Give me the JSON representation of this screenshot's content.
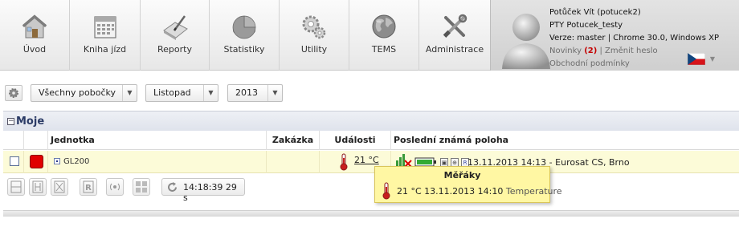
{
  "nav": {
    "items": [
      {
        "label": "Úvod",
        "icon": "home-icon"
      },
      {
        "label": "Kniha jízd",
        "icon": "calendar-icon"
      },
      {
        "label": "Reporty",
        "icon": "report-icon"
      },
      {
        "label": "Statistiky",
        "icon": "pie-chart-icon"
      },
      {
        "label": "Utility",
        "icon": "gears-icon"
      },
      {
        "label": "TEMS",
        "icon": "globe-icon"
      },
      {
        "label": "Administrace",
        "icon": "tools-icon"
      }
    ]
  },
  "user": {
    "name": "Potůček Vít (potucek2)",
    "company": "PTY Potucek_testy",
    "version_line": "Verze: master  |  Chrome 30.0, Windows XP",
    "news_label": "Novinky",
    "news_count": "(2)",
    "separator": "|",
    "change_password": "Změnit heslo",
    "terms": "Obchodní podmínky",
    "language_flag": "czech-flag"
  },
  "filters": {
    "branch": "Všechny pobočky",
    "month": "Listopad",
    "year": "2013"
  },
  "group": {
    "title": "Moje",
    "columns": {
      "unit": "Jednotka",
      "order": "Zakázka",
      "events": "Události",
      "position": "Poslední známá poloha"
    },
    "row": {
      "unit_name": "GL200",
      "temperature": "21 °C",
      "position": "13.11.2013 14:13 - Eurosat CS, Brno"
    },
    "timer": "14:18:39 29 s"
  },
  "tooltip": {
    "title": "Měřáky",
    "value": "21 °C 13.11.2013 14:10",
    "label": "Temperature"
  },
  "colors": {
    "status_red": "#e00000",
    "row_highlight": "#fcfbd8",
    "tooltip_bg": "#fff7a3",
    "group_title": "#2b3b66"
  }
}
